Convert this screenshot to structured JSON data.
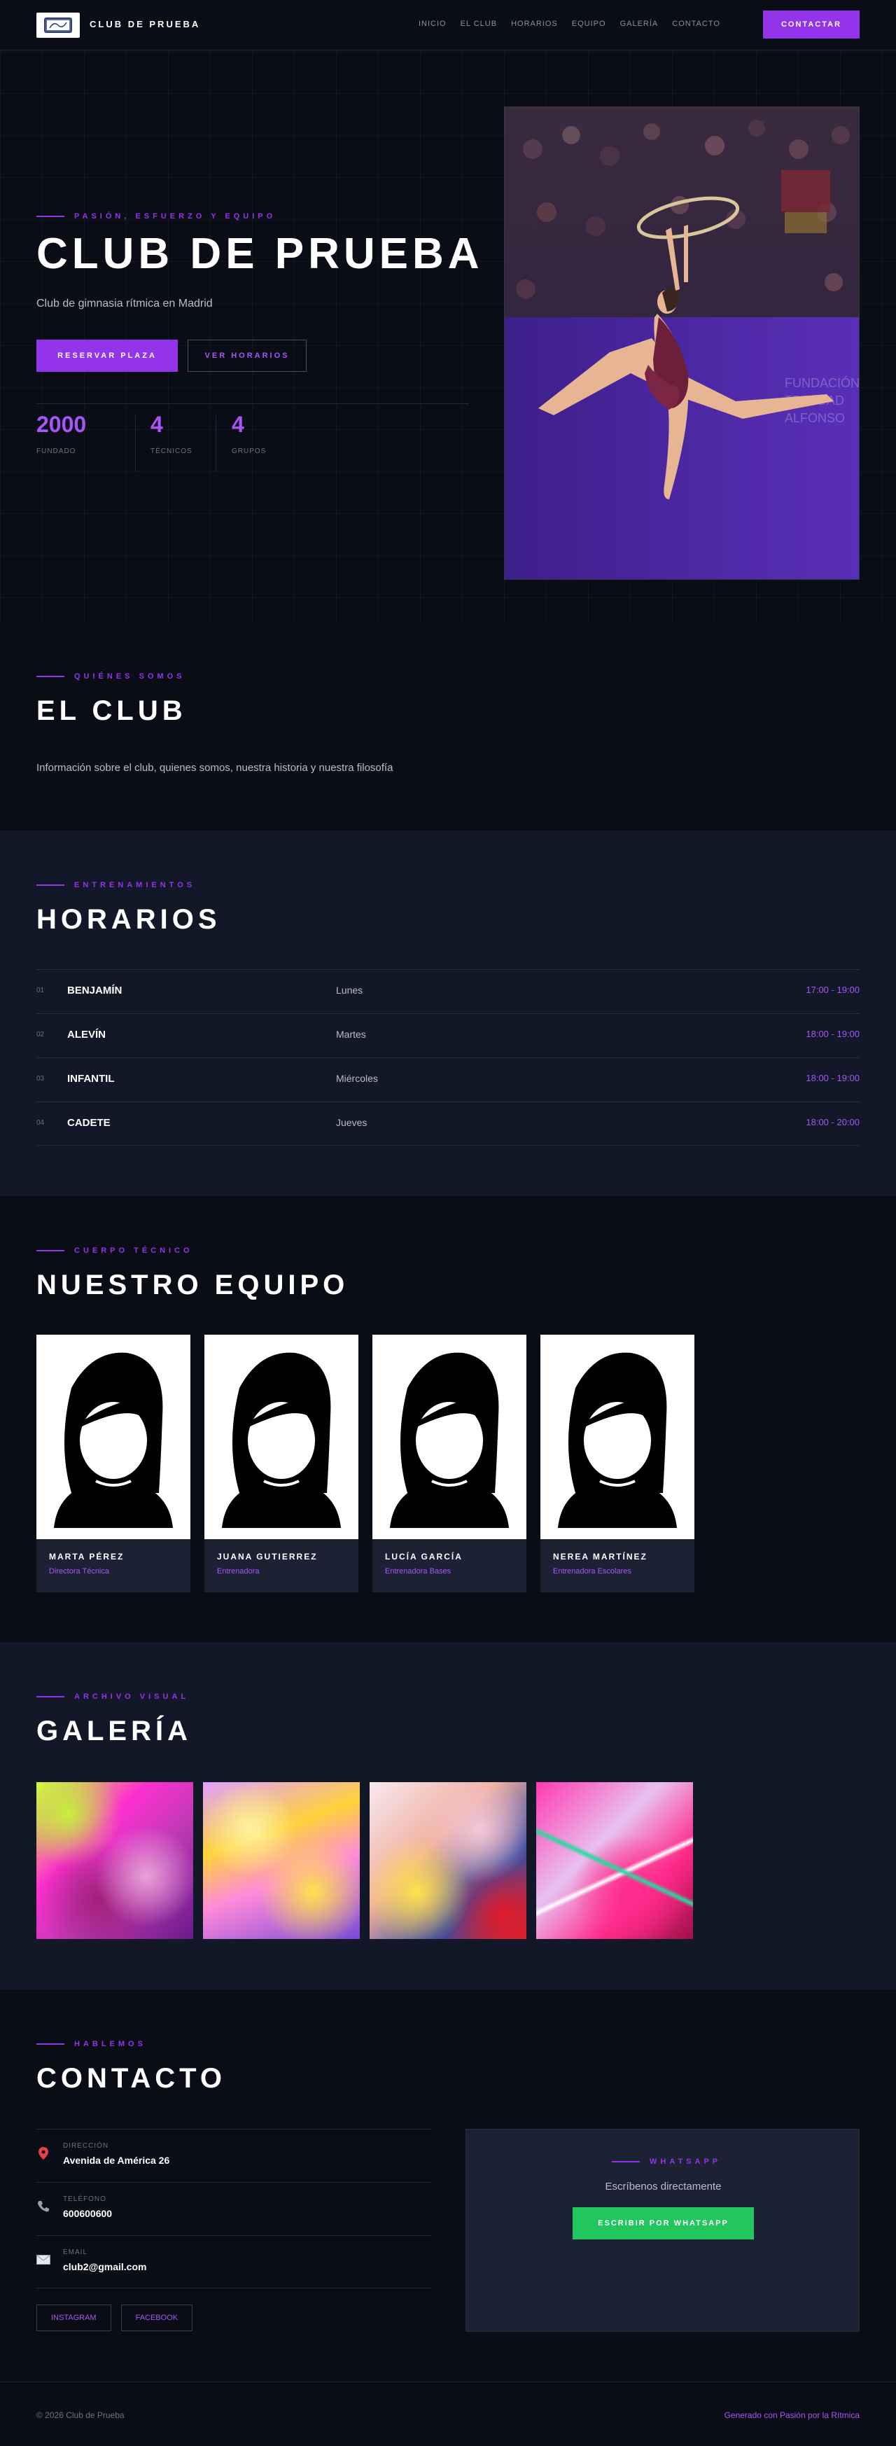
{
  "nav": {
    "brand": "CLUB DE PRUEBA",
    "items": [
      "INICIO",
      "EL CLUB",
      "HORARIOS",
      "EQUIPO",
      "GALERÍA",
      "CONTACTO"
    ],
    "cta": "CONTACTAR"
  },
  "hero": {
    "eyebrow": "PASIÓN, ESFUERZO Y EQUIPO",
    "title": "CLUB DE PRUEBA",
    "subtitle": "Club de gimnasia rítmica en Madrid",
    "primary_button": "RESERVAR PLAZA",
    "secondary_button": "VER HORARIOS",
    "stats": [
      {
        "value": "2000",
        "label": "FUNDADO"
      },
      {
        "value": "4",
        "label": "TÉCNICOS"
      },
      {
        "value": "4",
        "label": "GRUPOS"
      }
    ]
  },
  "club": {
    "eyebrow": "QUIÉNES SOMOS",
    "title": "EL CLUB",
    "text": "Información sobre el club, quienes somos, nuestra historia y nuestra filosofía"
  },
  "horarios": {
    "eyebrow": "ENTRENAMIENTOS",
    "title": "HORARIOS",
    "rows": [
      {
        "index": "01",
        "group": "BENJAMÍN",
        "day": "Lunes",
        "time": "17:00 - 19:00"
      },
      {
        "index": "02",
        "group": "ALEVÍN",
        "day": "Martes",
        "time": "18:00 - 19:00"
      },
      {
        "index": "03",
        "group": "INFANTIL",
        "day": "Miércoles",
        "time": "18:00 - 19:00"
      },
      {
        "index": "04",
        "group": "CADETE",
        "day": "Jueves",
        "time": "18:00 - 20:00"
      }
    ]
  },
  "equipo": {
    "eyebrow": "CUERPO TÉCNICO",
    "title": "NUESTRO EQUIPO",
    "members": [
      {
        "name": "MARTA PÉREZ",
        "role": "Directora Técnica"
      },
      {
        "name": "JUANA GUTIERREZ",
        "role": "Entrenadora"
      },
      {
        "name": "LUCÍA GARCÍA",
        "role": "Entrenadora Bases"
      },
      {
        "name": "NEREA MARTÍNEZ",
        "role": "Entrenadora Escolares"
      }
    ]
  },
  "galeria": {
    "eyebrow": "ARCHIVO VISUAL",
    "title": "GALERÍA"
  },
  "contacto": {
    "eyebrow": "HABLEMOS",
    "title": "CONTACTO",
    "items": [
      {
        "label": "DIRECCIÓN",
        "value": "Avenida de América 26",
        "icon": "map-pin-icon"
      },
      {
        "label": "TELÉFONO",
        "value": "600600600",
        "icon": "phone-icon"
      },
      {
        "label": "EMAIL",
        "value": "club2@gmail.com",
        "icon": "mail-icon"
      }
    ],
    "socials": [
      "INSTAGRAM",
      "FACEBOOK"
    ],
    "whatsapp": {
      "eyebrow": "WHATSAPP",
      "text": "Escríbenos directamente",
      "button": "ESCRIBIR POR WHATSAPP"
    }
  },
  "footer": {
    "copyright": "© 2026 Club de Prueba",
    "credit": "Generado con Pasión por la Rítmica"
  },
  "colors": {
    "accent": "#9333ea",
    "accent_text": "#a855f7",
    "background": "#0b0d16",
    "panel": "#121828",
    "whatsapp": "#22c55e"
  }
}
